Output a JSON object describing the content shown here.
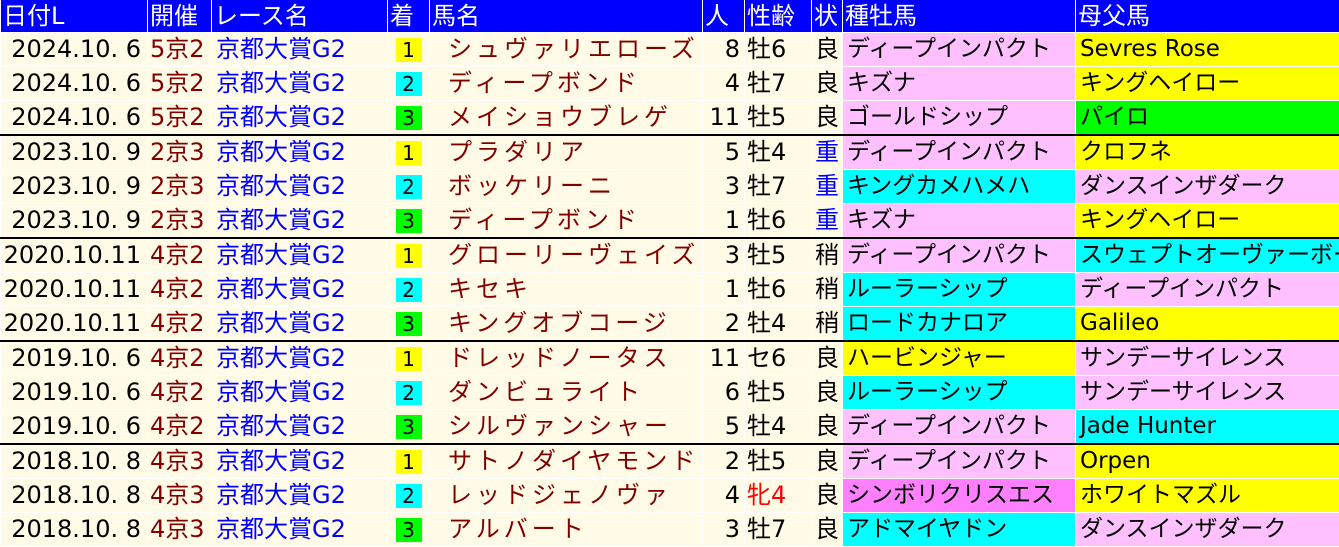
{
  "colors": {
    "header_bg": "#0000ff",
    "row_bg": "#fffbe7",
    "place_1": "#ffff00",
    "place_2": "#00ffff",
    "place_3": "#00ff00",
    "horse_text": "#800000",
    "race_text": "#0000ff"
  },
  "headers": [
    "日付L",
    "開催",
    "レース名",
    "着",
    "馬名",
    "人",
    "性齢",
    "状",
    "種牡馬",
    "母父馬"
  ],
  "rows": [
    {
      "date": "2024.10. 6",
      "kai": "5京2",
      "race": "京都大賞G2",
      "place": "1",
      "horse": "シュヴァリエローズ",
      "pop": "8",
      "sexage": "牡6",
      "cond": "良",
      "sire": "ディープインパクト",
      "bms": "Sevres Rose",
      "sire_bg": "#ffc0ff",
      "bms_bg": "#ffff00"
    },
    {
      "date": "2024.10. 6",
      "kai": "5京2",
      "race": "京都大賞G2",
      "place": "2",
      "horse": "ディープボンド",
      "pop": "4",
      "sexage": "牡7",
      "cond": "良",
      "sire": "キズナ",
      "bms": "キングヘイロー",
      "sire_bg": "#ffc0ff",
      "bms_bg": "#ffff00"
    },
    {
      "date": "2024.10. 6",
      "kai": "5京2",
      "race": "京都大賞G2",
      "place": "3",
      "horse": "メイショウブレゲ",
      "pop": "11",
      "sexage": "牡5",
      "cond": "良",
      "sire": "ゴールドシップ",
      "bms": "パイロ",
      "sire_bg": "#ffc0ff",
      "bms_bg": "#00ff00"
    },
    {
      "date": "2023.10. 9",
      "kai": "2京3",
      "race": "京都大賞G2",
      "place": "1",
      "horse": "プラダリア",
      "pop": "5",
      "sexage": "牡4",
      "cond": "重",
      "sire": "ディープインパクト",
      "bms": "クロフネ",
      "sire_bg": "#ffc0ff",
      "bms_bg": "#ffff00"
    },
    {
      "date": "2023.10. 9",
      "kai": "2京3",
      "race": "京都大賞G2",
      "place": "2",
      "horse": "ボッケリーニ",
      "pop": "3",
      "sexage": "牡7",
      "cond": "重",
      "sire": "キングカメハメハ",
      "bms": "ダンスインザダーク",
      "sire_bg": "#00ffff",
      "bms_bg": "#ffc0ff"
    },
    {
      "date": "2023.10. 9",
      "kai": "2京3",
      "race": "京都大賞G2",
      "place": "3",
      "horse": "ディープボンド",
      "pop": "1",
      "sexage": "牡6",
      "cond": "重",
      "sire": "キズナ",
      "bms": "キングヘイロー",
      "sire_bg": "#ffc0ff",
      "bms_bg": "#ffff00"
    },
    {
      "date": "2020.10.11",
      "kai": "4京2",
      "race": "京都大賞G2",
      "place": "1",
      "horse": "グローリーヴェイズ",
      "pop": "3",
      "sexage": "牡5",
      "cond": "稍",
      "sire": "ディープインパクト",
      "bms": "スウェプトオーヴァーボード",
      "sire_bg": "#ffc0ff",
      "bms_bg": "#00ffff"
    },
    {
      "date": "2020.10.11",
      "kai": "4京2",
      "race": "京都大賞G2",
      "place": "2",
      "horse": "キセキ",
      "pop": "1",
      "sexage": "牡6",
      "cond": "稍",
      "sire": "ルーラーシップ",
      "bms": "ディープインパクト",
      "sire_bg": "#00ffff",
      "bms_bg": "#ffc0ff"
    },
    {
      "date": "2020.10.11",
      "kai": "4京2",
      "race": "京都大賞G2",
      "place": "3",
      "horse": "キングオブコージ",
      "pop": "2",
      "sexage": "牡4",
      "cond": "稍",
      "sire": "ロードカナロア",
      "bms": "Galileo",
      "sire_bg": "#00ffff",
      "bms_bg": "#ffff00"
    },
    {
      "date": "2019.10. 6",
      "kai": "4京2",
      "race": "京都大賞G2",
      "place": "1",
      "horse": "ドレッドノータス",
      "pop": "11",
      "sexage": "セ6",
      "cond": "良",
      "sire": "ハービンジャー",
      "bms": "サンデーサイレンス",
      "sire_bg": "#ffff00",
      "bms_bg": "#ffc0ff"
    },
    {
      "date": "2019.10. 6",
      "kai": "4京2",
      "race": "京都大賞G2",
      "place": "2",
      "horse": "ダンビュライト",
      "pop": "6",
      "sexage": "牡5",
      "cond": "良",
      "sire": "ルーラーシップ",
      "bms": "サンデーサイレンス",
      "sire_bg": "#00ffff",
      "bms_bg": "#ffc0ff"
    },
    {
      "date": "2019.10. 6",
      "kai": "4京2",
      "race": "京都大賞G2",
      "place": "3",
      "horse": "シルヴァンシャー",
      "pop": "5",
      "sexage": "牡4",
      "cond": "良",
      "sire": "ディープインパクト",
      "bms": "Jade Hunter",
      "sire_bg": "#ffc0ff",
      "bms_bg": "#00ffff"
    },
    {
      "date": "2018.10. 8",
      "kai": "4京3",
      "race": "京都大賞G2",
      "place": "1",
      "horse": "サトノダイヤモンド",
      "pop": "2",
      "sexage": "牡5",
      "cond": "良",
      "sire": "ディープインパクト",
      "bms": "Orpen",
      "sire_bg": "#ffc0ff",
      "bms_bg": "#ffff00"
    },
    {
      "date": "2018.10. 8",
      "kai": "4京3",
      "race": "京都大賞G2",
      "place": "2",
      "horse": "レッドジェノヴァ",
      "pop": "4",
      "sexage": "牝4",
      "cond": "良",
      "sire": "シンボリクリスエス",
      "bms": "ホワイトマズル",
      "sire_bg": "#ff80ff",
      "bms_bg": "#ffff00"
    },
    {
      "date": "2018.10. 8",
      "kai": "4京3",
      "race": "京都大賞G2",
      "place": "3",
      "horse": "アルバート",
      "pop": "3",
      "sexage": "牡7",
      "cond": "良",
      "sire": "アドマイヤドン",
      "bms": "ダンスインザダーク",
      "sire_bg": "#00ffff",
      "bms_bg": "#ffc0ff"
    }
  ]
}
